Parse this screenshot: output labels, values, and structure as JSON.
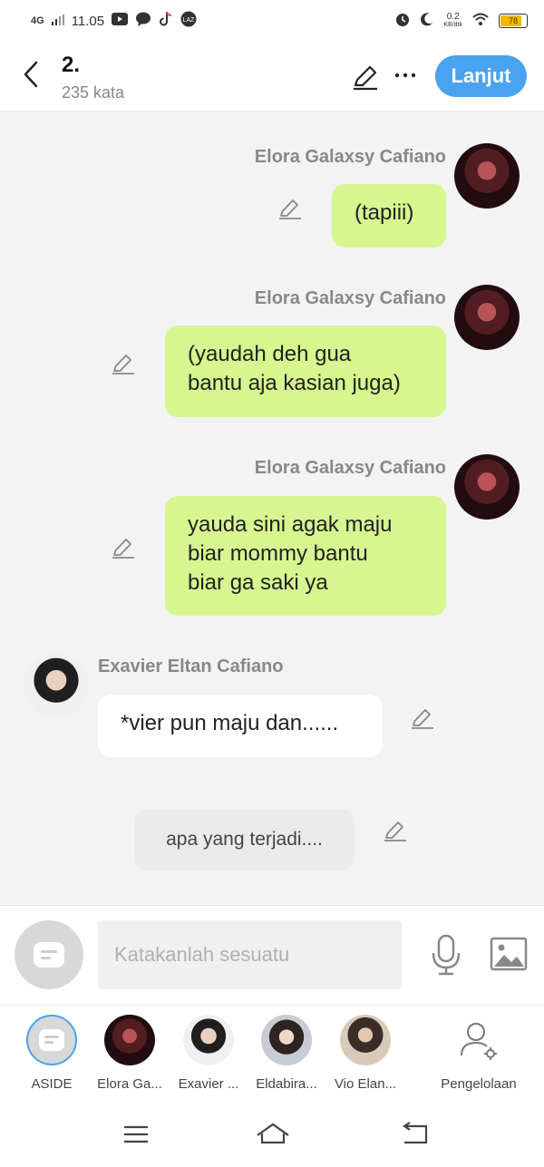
{
  "status_bar": {
    "network": "4G",
    "time": "11.05",
    "speed_value": "0.2",
    "speed_unit": "KB/dtk",
    "battery": "78"
  },
  "header": {
    "title": "2.",
    "word_count": "235 kata",
    "next_label": "Lanjut"
  },
  "messages": [
    {
      "sender": "Elora Galaxsy Cafiano",
      "text": "(tapiii)"
    },
    {
      "sender": "Elora Galaxsy Cafiano",
      "text": "(yaudah deh gua\nbantu aja kasian juga)"
    },
    {
      "sender": "Elora Galaxsy Cafiano",
      "text": "yauda sini agak maju\nbiar mommy bantu\nbiar ga saki ya"
    },
    {
      "sender": "Exavier Eltan Cafiano",
      "text": "*vier pun maju dan......"
    },
    {
      "sender": "",
      "text": "apa yang terjadi...."
    }
  ],
  "composer": {
    "placeholder": "Katakanlah sesuatu"
  },
  "characters": [
    {
      "label": "ASIDE"
    },
    {
      "label": "Elora Ga..."
    },
    {
      "label": "Exavier ..."
    },
    {
      "label": "Eldabira..."
    },
    {
      "label": "Vio Elan..."
    },
    {
      "label": "Pengelolaan"
    }
  ],
  "theme": {
    "accent": "#4aa3f0",
    "bubble_green": "#d6f690",
    "background": "#f3f3f3"
  }
}
